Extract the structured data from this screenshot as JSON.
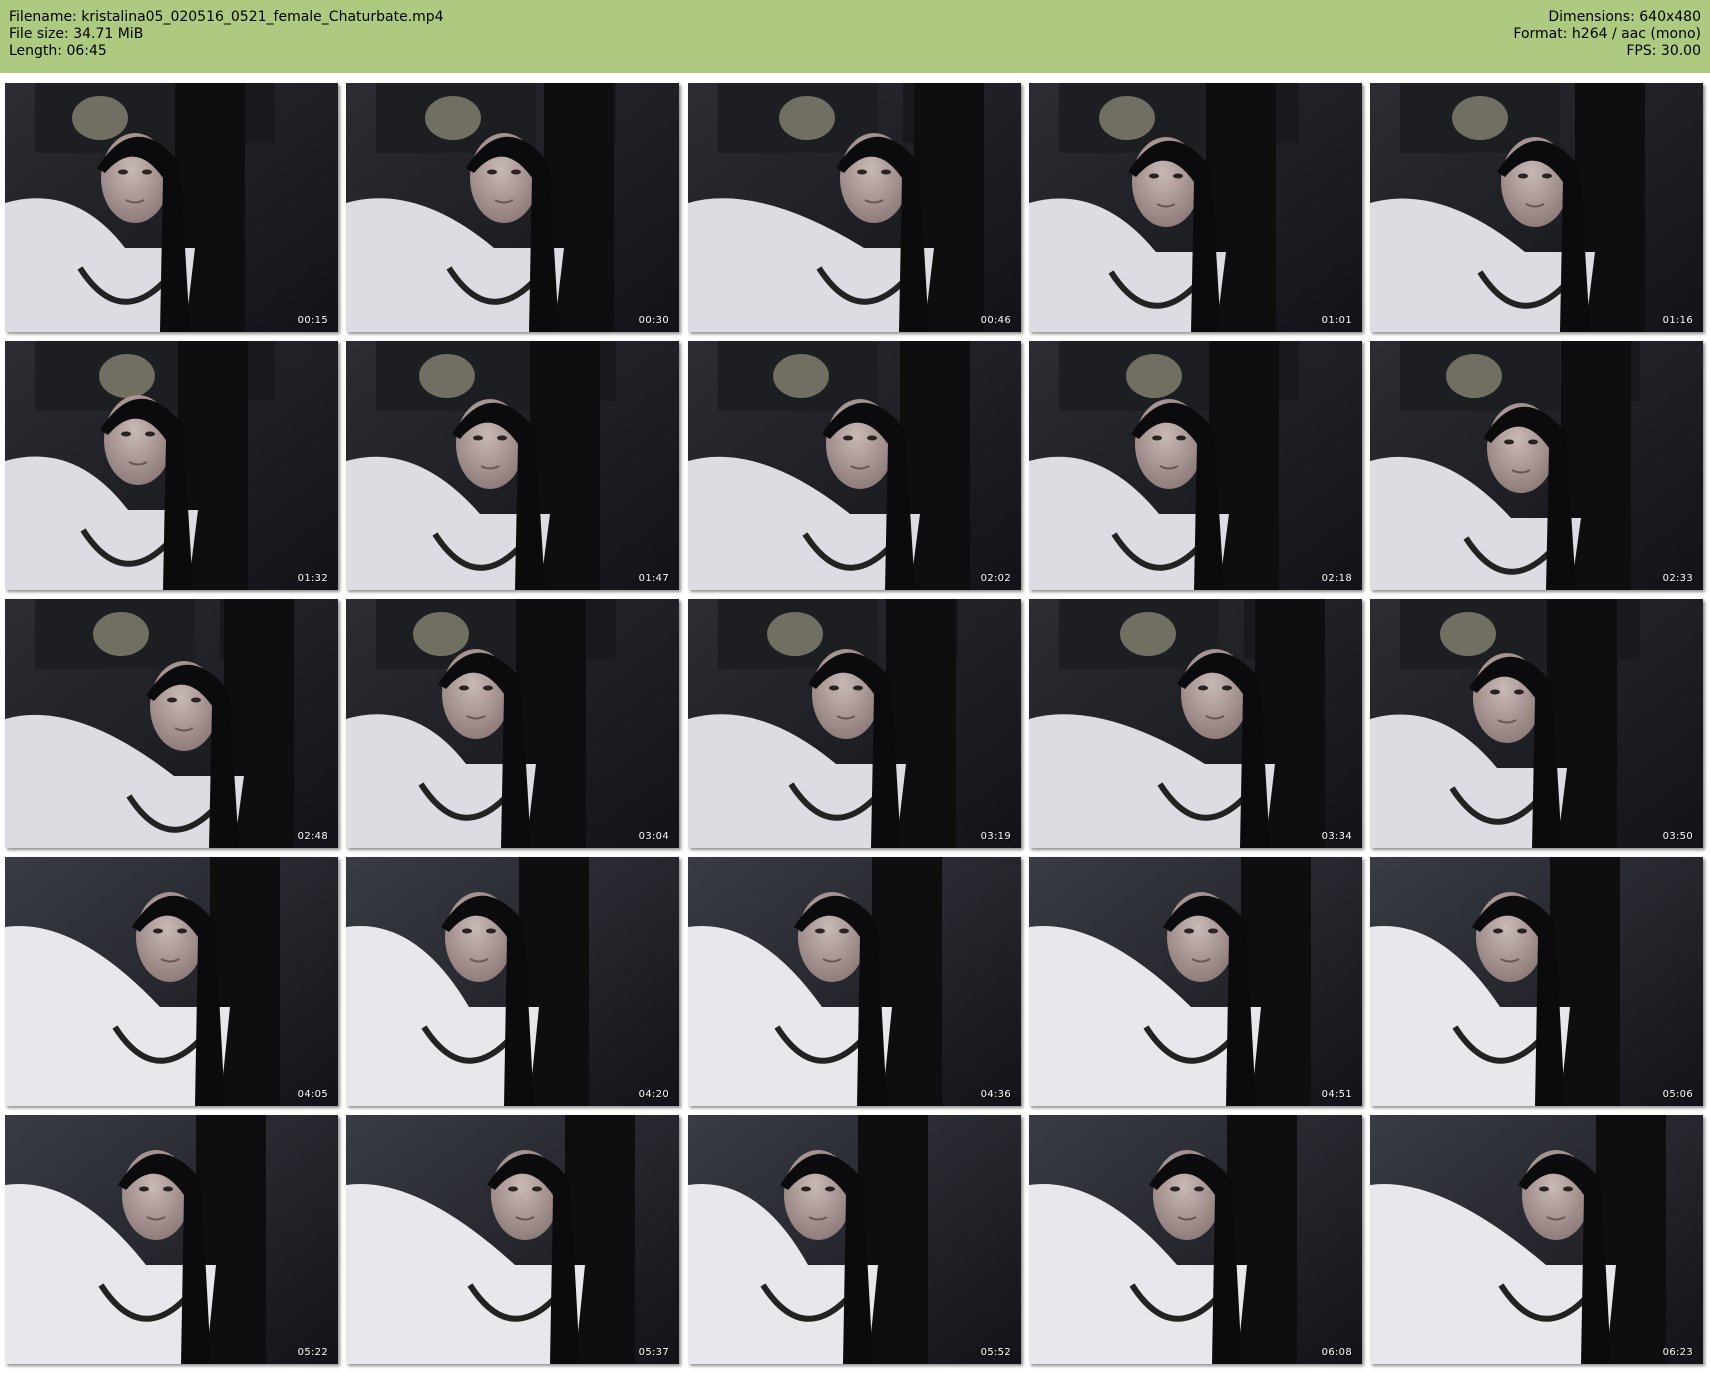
{
  "header": {
    "filename": "Filename: kristalina05_020516_0521_female_Chaturbate.mp4",
    "filesize": "File size: 34.71 MiB",
    "length": "Length: 06:45",
    "dimensions": "Dimensions: 640x480",
    "format": "Format: h264 / aac (mono)",
    "fps": "FPS: 30.00",
    "background_color": "#adca80"
  },
  "thumbnails": [
    {
      "timestamp": "00:15"
    },
    {
      "timestamp": "00:30"
    },
    {
      "timestamp": "00:46"
    },
    {
      "timestamp": "01:01"
    },
    {
      "timestamp": "01:16"
    },
    {
      "timestamp": "01:32"
    },
    {
      "timestamp": "01:47"
    },
    {
      "timestamp": "02:02"
    },
    {
      "timestamp": "02:18"
    },
    {
      "timestamp": "02:33"
    },
    {
      "timestamp": "02:48"
    },
    {
      "timestamp": "03:04"
    },
    {
      "timestamp": "03:19"
    },
    {
      "timestamp": "03:34"
    },
    {
      "timestamp": "03:50"
    },
    {
      "timestamp": "04:05"
    },
    {
      "timestamp": "04:20"
    },
    {
      "timestamp": "04:36"
    },
    {
      "timestamp": "04:51"
    },
    {
      "timestamp": "05:06"
    },
    {
      "timestamp": "05:22"
    },
    {
      "timestamp": "05:37"
    },
    {
      "timestamp": "05:52"
    },
    {
      "timestamp": "06:08"
    },
    {
      "timestamp": "06:23"
    }
  ]
}
